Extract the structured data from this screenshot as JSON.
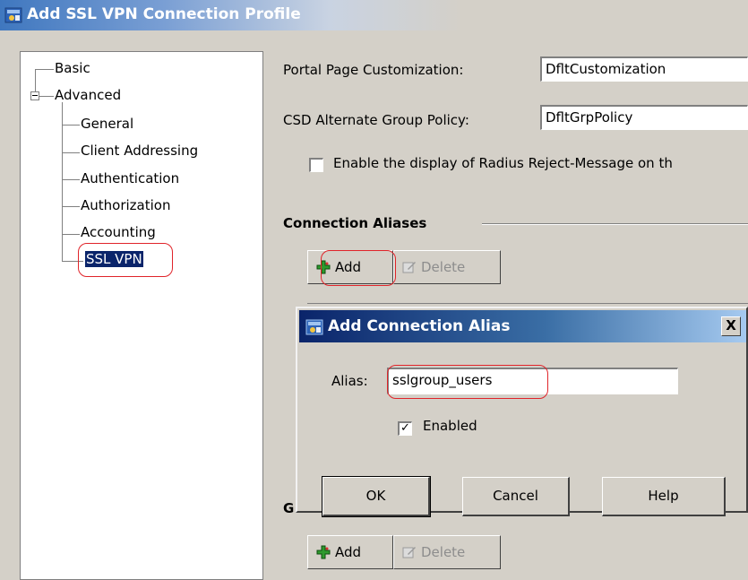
{
  "window": {
    "title": "Add SSL VPN Connection Profile"
  },
  "tree": {
    "items": [
      {
        "label": "Basic"
      },
      {
        "label": "Advanced"
      },
      {
        "label": "General"
      },
      {
        "label": "Client Addressing"
      },
      {
        "label": "Authentication"
      },
      {
        "label": "Authorization"
      },
      {
        "label": "Accounting"
      },
      {
        "label": "SSL VPN",
        "selected": true
      }
    ]
  },
  "main": {
    "portal_label": "Portal Page Customization:",
    "portal_value": "DfltCustomization",
    "csd_label": "CSD Alternate Group Policy:",
    "csd_value": "DfltGrpPolicy",
    "radius_checkbox_label": "Enable the display of Radius Reject-Message on th",
    "radius_checked": false,
    "aliases_section_title": "Connection Aliases",
    "add_label": "Add",
    "delete_label": "Delete",
    "obscured_section_letter": "G",
    "add2_label": "Add",
    "delete2_label": "Delete"
  },
  "dialog": {
    "title": "Add Connection Alias",
    "close_glyph": "X",
    "alias_label": "Alias:",
    "alias_value": "sslgroup_users",
    "enabled_label": "Enabled",
    "enabled_checked": true,
    "ok_label": "OK",
    "cancel_label": "Cancel",
    "help_label": "Help"
  },
  "icons": {
    "app": "asdm-app-icon",
    "add": "green-plus-icon",
    "delete": "edit-delete-icon"
  },
  "colors": {
    "highlight": "#e0242a",
    "selection": "#0a246a",
    "dialog_title": "#0a246a"
  }
}
